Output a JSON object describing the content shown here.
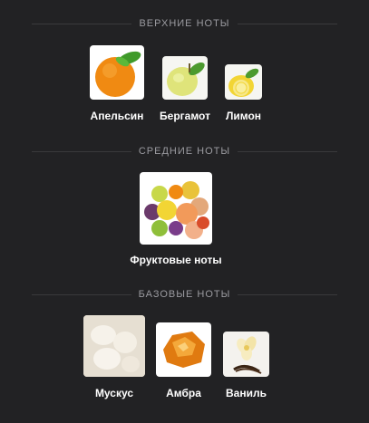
{
  "sections": {
    "top": {
      "title": "ВЕРХНИЕ НОТЫ",
      "items": [
        {
          "label": "Апельсин",
          "icon": "orange-icon"
        },
        {
          "label": "Бергамот",
          "icon": "bergamot-icon"
        },
        {
          "label": "Лимон",
          "icon": "lemon-icon"
        }
      ]
    },
    "middle": {
      "title": "СРЕДНИЕ НОТЫ",
      "items": [
        {
          "label": "Фруктовые ноты",
          "icon": "fruits-icon"
        }
      ]
    },
    "base": {
      "title": "БАЗОВЫЕ НОТЫ",
      "items": [
        {
          "label": "Мускус",
          "icon": "musk-icon"
        },
        {
          "label": "Амбра",
          "icon": "amber-icon"
        },
        {
          "label": "Ваниль",
          "icon": "vanilla-icon"
        }
      ]
    }
  },
  "colors": {
    "background": "#222224",
    "section_title": "#9b9ba0",
    "label": "#ffffff"
  }
}
